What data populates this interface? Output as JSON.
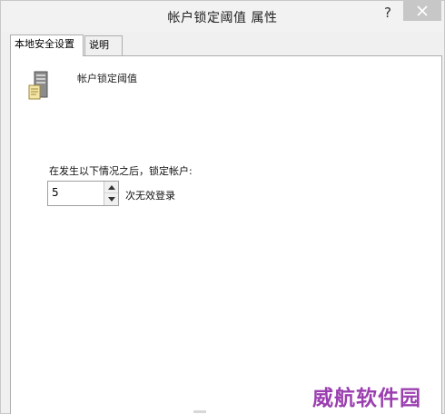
{
  "window": {
    "title": "帐户锁定阈值 属性",
    "help_label": "?"
  },
  "tabs": [
    {
      "label": "本地安全设置",
      "active": true
    },
    {
      "label": "说明",
      "active": false
    }
  ],
  "policy": {
    "icon": "server-policy-icon",
    "name": "帐户锁定阈值"
  },
  "setting": {
    "instruction": "在发生以下情况之后，锁定帐户:",
    "value": "5",
    "unit_label": "次无效登录"
  },
  "watermark": {
    "text": "威航软件园",
    "color": "#9b3fb0"
  }
}
